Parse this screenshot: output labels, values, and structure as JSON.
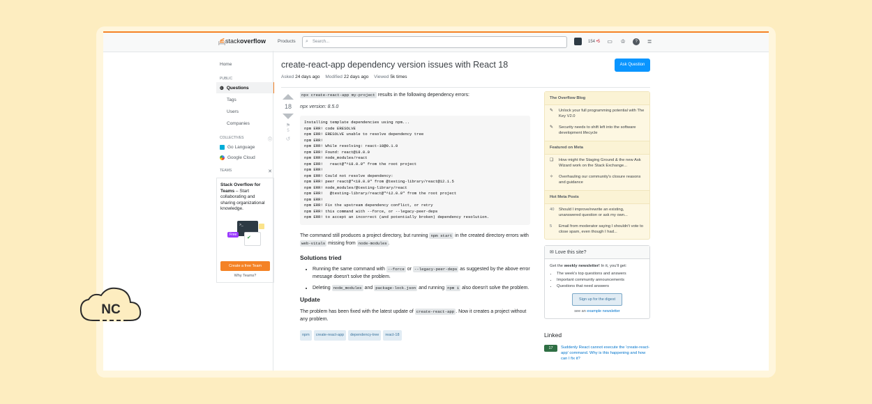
{
  "topbar": {
    "logo_prefix": "stack",
    "logo_bold": "overflow",
    "products": "Products",
    "search_placeholder": "Search...",
    "rep": "154",
    "rep_badge": "5"
  },
  "leftnav": {
    "home": "Home",
    "public": "PUBLIC",
    "questions": "Questions",
    "tags": "Tags",
    "users": "Users",
    "companies": "Companies",
    "collectives": "COLLECTIVES",
    "go": "Go Language",
    "gcloud": "Google Cloud",
    "teams": "TEAMS",
    "teams_title": "Stack Overflow for Teams",
    "teams_text": " – Start collaborating and sharing organizational knowledge.",
    "free": "Free",
    "create_team": "Create a free Team",
    "why_teams": "Why Teams?"
  },
  "question": {
    "title": "create-react-app dependency version issues with React 18",
    "asked_label": "Asked",
    "asked": "24 days ago",
    "modified_label": "Modified",
    "modified": "22 days ago",
    "viewed_label": "Viewed",
    "viewed": "5k times",
    "ask_button": "Ask Question",
    "votes": "18",
    "bookmarks": "5"
  },
  "post": {
    "intro_code": "npx create-react-app my-project",
    "intro_text": " results in the following dependency errors:",
    "npx_version": "npx version: 8.5.0",
    "code_block": "Installing template dependencies using npm...\nnpm ERR! code ERESOLVE\nnpm ERR! ERESOLVE unable to resolve dependency tree\nnpm ERR!\nnpm ERR! While resolving: react-18@0.1.0\nnpm ERR! Found: react@18.0.0\nnpm ERR! node_modules/react\nnpm ERR!   react@\"^18.0.0\" from the root project\nnpm ERR!\nnpm ERR! Could not resolve dependency:\nnpm ERR! peer react@\"<18.0.0\" from @testing-library/react@12.1.5\nnpm ERR! node_modules/@testing-library/react\nnpm ERR!   @testing-library/react@\"^12.0.0\" from the root project\nnpm ERR!\nnpm ERR! Fix the upstream dependency conflict, or retry\nnpm ERR! this command with --force, or --legacy-peer-deps\nnpm ERR! to accept an incorrect (and potentially broken) dependency resolution.",
    "p2_a": "The command still produces a project directory, but running ",
    "p2_code1": "npm start",
    "p2_b": " in the created directory errors with ",
    "p2_code2": "web-vitals",
    "p2_c": " missing from ",
    "p2_code3": "node-modules",
    "p2_d": ".",
    "solutions_heading": "Solutions tried",
    "li1_a": "Running the same command with ",
    "li1_code1": "--force",
    "li1_b": " or ",
    "li1_code2": "--legacy-peer-deps",
    "li1_c": " as suggested by the above error message doesn't solve the problem.",
    "li2_a": "Deleting ",
    "li2_code1": "node_modules",
    "li2_b": " and ",
    "li2_code2": "package-lock.json",
    "li2_c": " and running ",
    "li2_code3": "npm i",
    "li2_d": " also doesn't solve the problem.",
    "update_heading": "Update",
    "update_a": "The problem has been fixed with the latest update of ",
    "update_code": "create-react-app",
    "update_b": ". Now it creates a project without any problem.",
    "tags": [
      "npm",
      "create-react-app",
      "dependency-tree",
      "react-18"
    ]
  },
  "sidebar": {
    "blog_heading": "The Overflow Blog",
    "blog1": "Unlock your full programming potential with The Key V2.0",
    "blog2": "Security needs to shift left into the software development lifecycle",
    "meta_heading": "Featured on Meta",
    "meta1": "How might the Staging Ground & the new Ask Wizard work on the Stack Exchange...",
    "meta2": "Overhauling our community's closure reasons and guidance",
    "hot_heading": "Hot Meta Posts",
    "hot1_count": "40",
    "hot1": "Should I improve/rewrite an existing, unanswered question or ask my own...",
    "hot2_count": "5",
    "hot2": "Email from moderator saying I shouldn't vote to close spam, even though I had...",
    "nl_heading": "Love this site?",
    "nl_a": "Get the ",
    "nl_b": "weekly newsletter!",
    "nl_c": " In it, you'll get:",
    "nl_items": [
      "The week's top questions and answers",
      "Important community announcements",
      "Questions that need answers"
    ],
    "digest": "Sign up for the digest",
    "see_a": "see an ",
    "see_b": "example newsletter",
    "linked_heading": "Linked",
    "linked1_votes": "17",
    "linked1": "Suddenly React cannot execute the 'create-react-app' command. Why is this happening and how can I fix it?"
  },
  "badge": {
    "text": "NC"
  },
  "colors": {
    "accent": "#f48225",
    "link": "#0074cc",
    "ask_button": "#0a95ff",
    "background": "#fdedc0"
  }
}
